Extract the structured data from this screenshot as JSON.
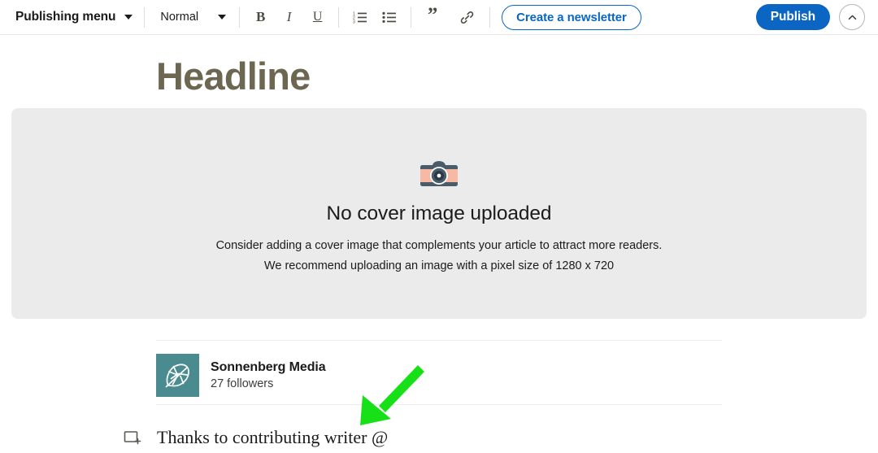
{
  "toolbar": {
    "publishing_menu_label": "Publishing menu",
    "publishing_menu_caret": "chevron-down-icon",
    "style_label": "Normal",
    "style_caret": "chevron-down-icon",
    "bold_label": "B",
    "italic_label": "I",
    "underline_label": "U",
    "ordered_list_icon": "ordered-list-icon",
    "bulleted_list_icon": "bulleted-list-icon",
    "quote_label": "”",
    "link_icon": "link-icon",
    "newsletter_label": "Create a newsletter",
    "publish_label": "Publish",
    "collapse_icon": "chevron-up-icon"
  },
  "editor": {
    "headline_placeholder": "Headline"
  },
  "cover": {
    "icon": "camera-icon",
    "title": "No cover image uploaded",
    "line1": "Consider adding a cover image that complements your article to attract more readers.",
    "line2": "We recommend uploading an image with a pixel size of 1280 x 720"
  },
  "author": {
    "avatar_icon": "sonnenberg-leaf-logo",
    "name": "Sonnenberg Media",
    "followers": "27 followers"
  },
  "body": {
    "add_block_icon": "add-block-icon",
    "paragraph": "Thanks to contributing writer @"
  },
  "annotation": {
    "arrow_icon": "green-arrow-icon"
  },
  "colors": {
    "brand_blue": "#0a66c2",
    "panel_gray": "#ebebeb",
    "headline_placeholder": "#6d6650",
    "avatar_teal": "#4a8b8f",
    "annotation_green": "#18e018"
  }
}
